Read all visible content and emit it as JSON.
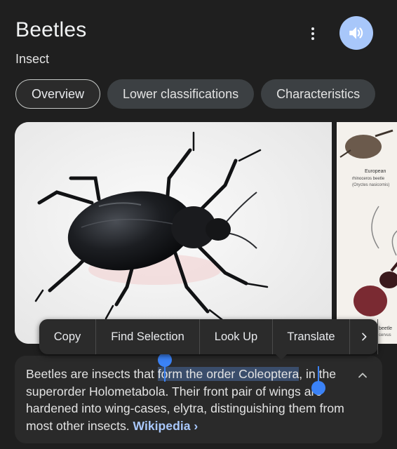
{
  "header": {
    "title": "Beetles",
    "subtitle": "Insect",
    "more_icon": "more-vert-icon",
    "speaker_icon": "volume-icon"
  },
  "tabs": [
    {
      "label": "Overview",
      "active": true
    },
    {
      "label": "Lower classifications",
      "active": false
    },
    {
      "label": "Characteristics",
      "active": false
    }
  ],
  "images": {
    "side_caption_1": "European",
    "side_caption_2": "rhinoceros beetle",
    "side_caption_3": "(Oryctes nasicornis)",
    "side_caption_4": "beetle",
    "side_caption_5": "cervus"
  },
  "context_menu": {
    "items": [
      "Copy",
      "Find Selection",
      "Look Up",
      "Translate"
    ],
    "more_icon": "chevron-right-icon"
  },
  "description": {
    "before": "Beetles are insects that ",
    "selected": "form the order Coleoptera",
    "after_selected": ", in the superorder Holometabola. Their front pair of wings are hardened into wing-cases, elytra, distinguishing them from most other insects. ",
    "source": "Wikipedia",
    "source_arrow": "›",
    "collapse_icon": "chevron-up-icon"
  },
  "colors": {
    "background": "#1f1f1f",
    "accent": "#a8c7fa",
    "selection": "#3a4d6b",
    "handle": "#3b82f6"
  }
}
